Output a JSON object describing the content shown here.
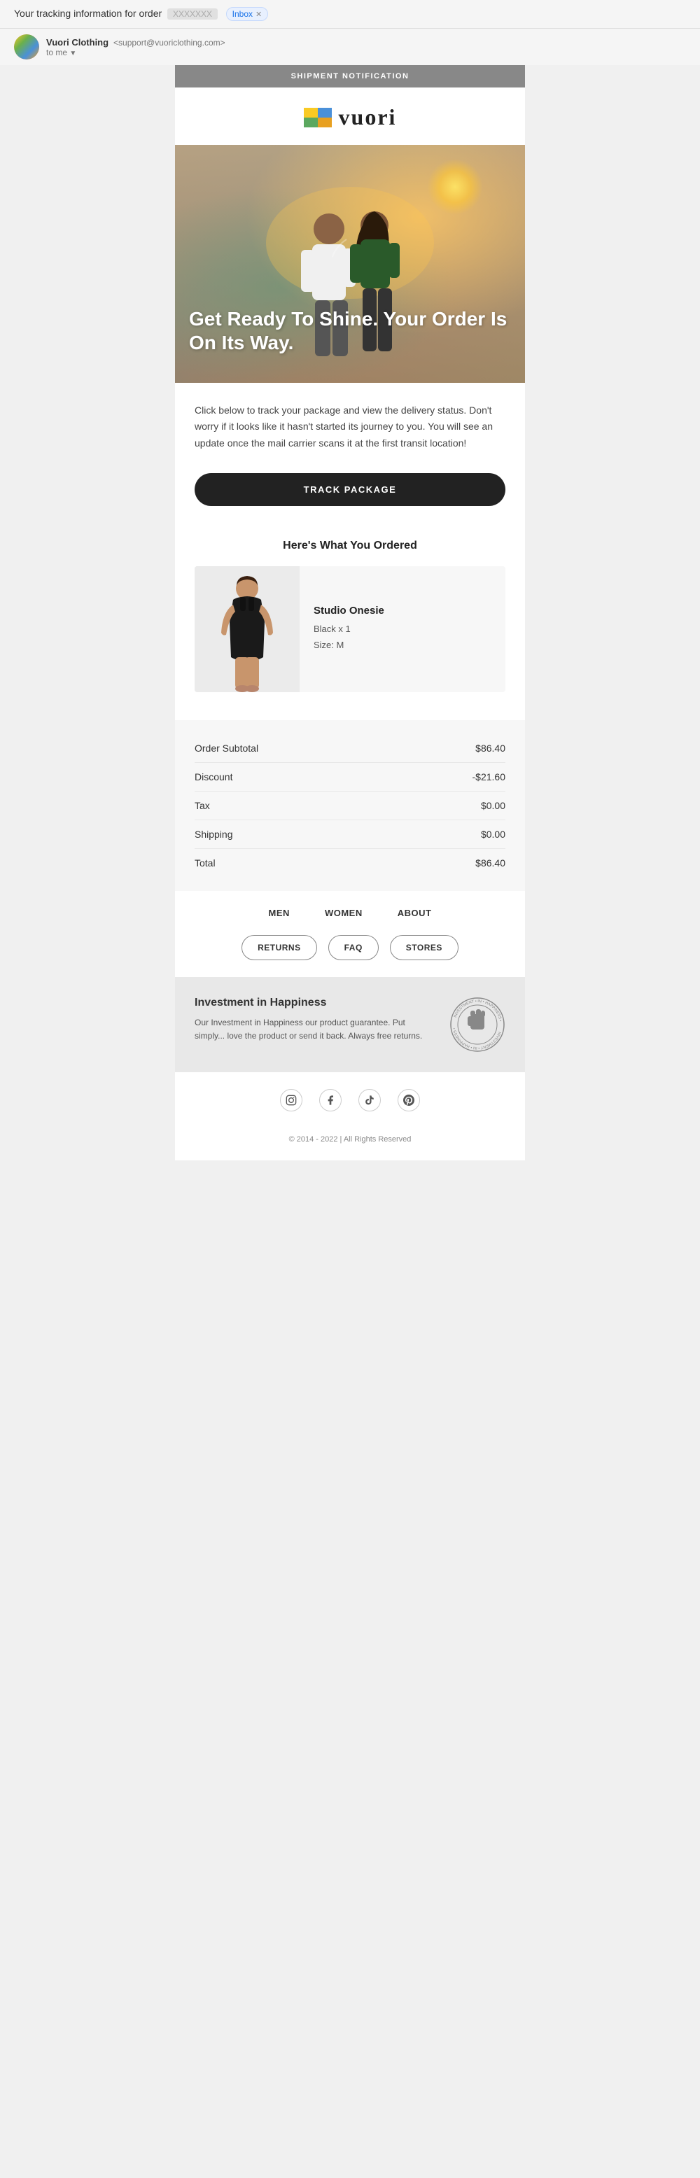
{
  "email_chrome": {
    "subject": "Your tracking information for order",
    "order_number": "XXXXXXX",
    "inbox_label": "Inbox",
    "sender_name": "Vuori Clothing",
    "sender_email": "support@vuoriclothing.com",
    "to_label": "to me"
  },
  "email_body": {
    "shipment_header": "SHIPMENT NOTIFICATION",
    "logo_text": "vuori",
    "hero_headline": "Get Ready To Shine. Your Order Is On Its Way.",
    "body_text": "Click below to track your package and view the delivery status. Don't worry if it looks like it hasn't started its journey to you. You will see an update once the mail carrier scans it at the first transit location!",
    "track_button_label": "TRACK PACKAGE",
    "order_section_title": "Here's What You Ordered",
    "product": {
      "name": "Studio Onesie",
      "color": "Black x 1",
      "size": "Size: M"
    },
    "order_summary": {
      "rows": [
        {
          "label": "Order Subtotal",
          "value": "$86.40"
        },
        {
          "label": "Discount",
          "value": "-$21.60"
        },
        {
          "label": "Tax",
          "value": "$0.00"
        },
        {
          "label": "Shipping",
          "value": "$0.00"
        },
        {
          "label": "Total",
          "value": "$86.40"
        }
      ]
    },
    "nav_links": [
      {
        "label": "MEN"
      },
      {
        "label": "WOMEN"
      },
      {
        "label": "ABOUT"
      }
    ],
    "action_buttons": [
      {
        "label": "RETURNS"
      },
      {
        "label": "FAQ"
      },
      {
        "label": "STORES"
      }
    ],
    "investment": {
      "title": "Investment in Happiness",
      "description": "Our Investment in Happiness our product guarantee. Put simply... love the product or send it back. Always free returns."
    },
    "social_icons": [
      {
        "name": "instagram",
        "symbol": "📷"
      },
      {
        "name": "facebook",
        "symbol": "f"
      },
      {
        "name": "tiktok",
        "symbol": "♪"
      },
      {
        "name": "pinterest",
        "symbol": "P"
      }
    ],
    "footer_text": "© 2014 - 2022 | All Rights Reserved"
  }
}
